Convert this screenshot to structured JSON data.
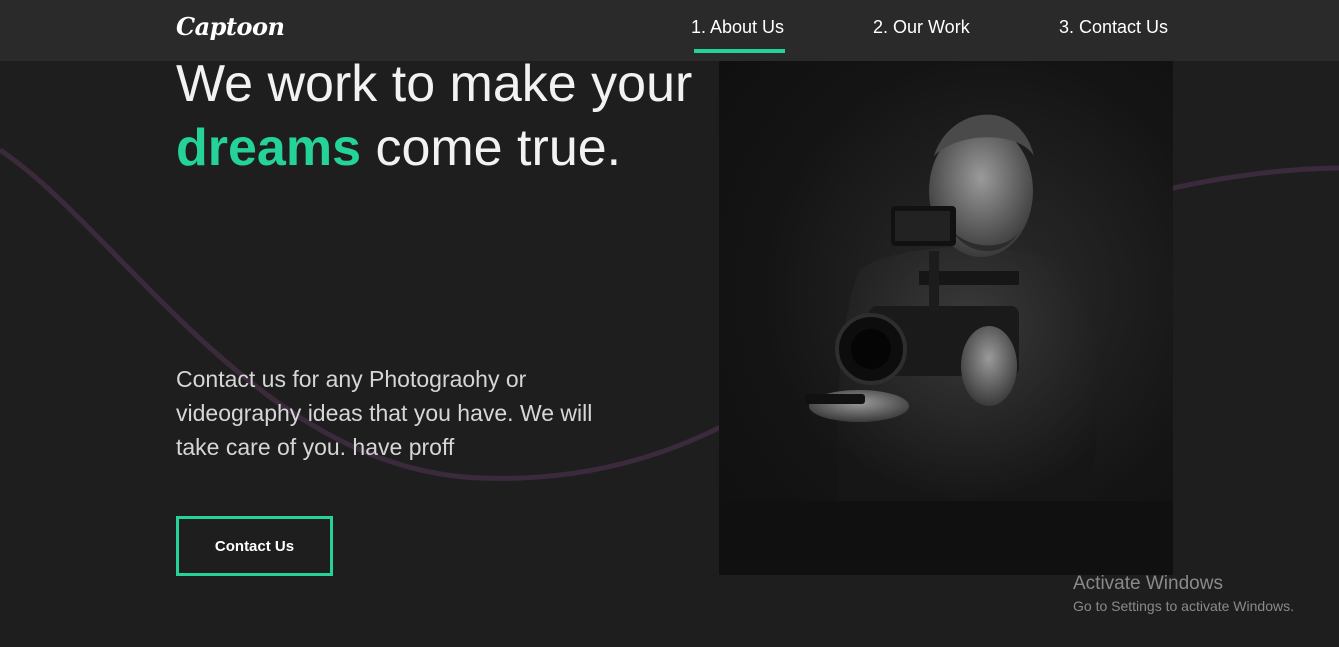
{
  "header": {
    "logo": "Captoon",
    "nav": [
      {
        "label": "1. About Us",
        "active": true
      },
      {
        "label": "2. Our Work",
        "active": false
      },
      {
        "label": "3. Contact Us",
        "active": false
      }
    ]
  },
  "hero": {
    "headline_pre": "We work to make your ",
    "headline_accent": "dreams",
    "headline_post": " come true.",
    "description": "Contact us for any Photograohy or videography ideas that you have. We will take care of you. have proff",
    "cta_label": "Contact Us",
    "image": "photographer-with-camera-rig"
  },
  "watermark": {
    "title": "Activate Windows",
    "subtitle": "Go to Settings to activate Windows."
  },
  "colors": {
    "accent": "#25d39a",
    "background": "#1e1e1e",
    "header_bg": "#2a2a2a",
    "curve": "#3a2a3c"
  }
}
